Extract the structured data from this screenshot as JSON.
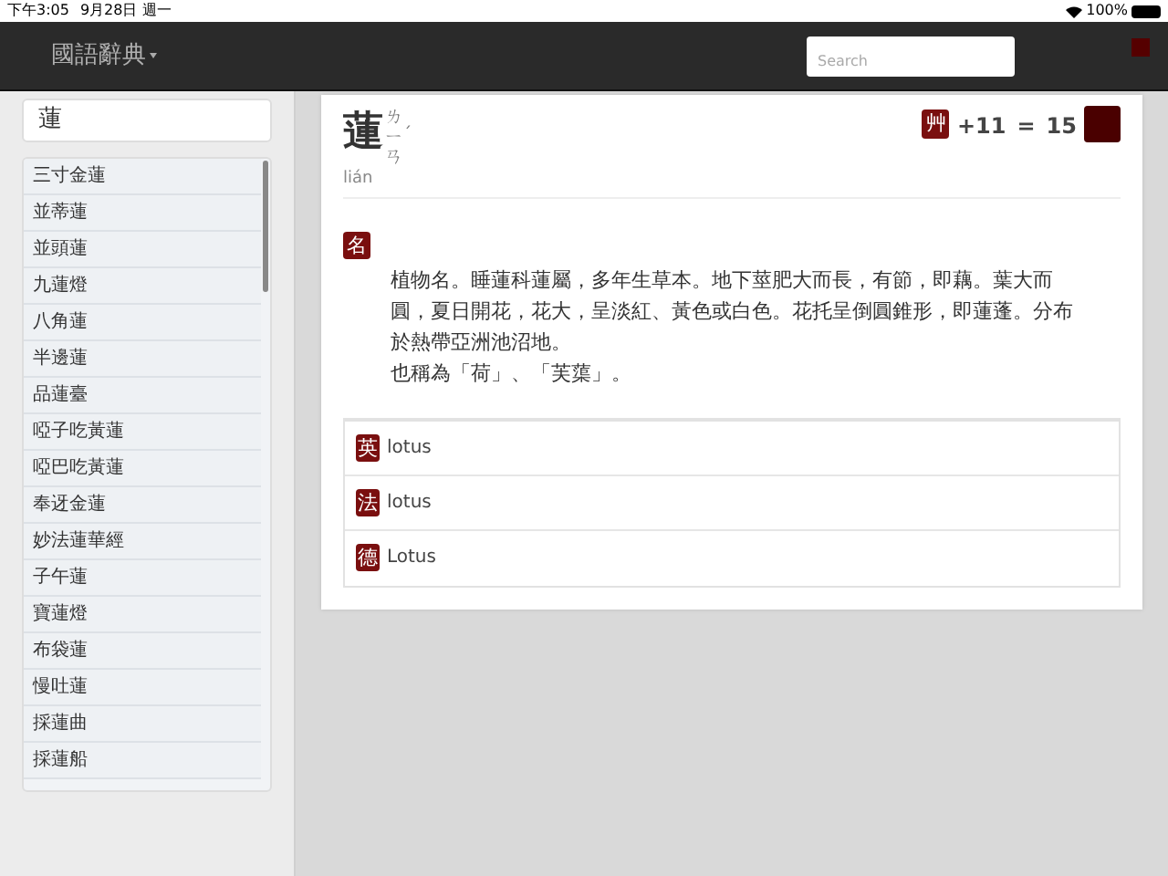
{
  "status_bar": {
    "time": "下午3:05",
    "date": "9月28日 週一",
    "battery": "100%"
  },
  "header": {
    "title": "國語辭典",
    "search": {
      "placeholder": "Search"
    }
  },
  "sidebar": {
    "search_value": "蓮",
    "items": [
      "三寸金蓮",
      "並蒂蓮",
      "並頭蓮",
      "九蓮燈",
      "八角蓮",
      "半邊蓮",
      "品蓮臺",
      "啞子吃黃蓮",
      "啞巴吃黃蓮",
      "奉迓金蓮",
      "妙法蓮華經",
      "子午蓮",
      "寶蓮燈",
      "布袋蓮",
      "慢吐蓮",
      "採蓮曲",
      "採蓮船"
    ]
  },
  "entry": {
    "character": "蓮",
    "bopomofo": "ㄌㄧㄢ",
    "tone": "ˊ",
    "pinyin": "lián",
    "radical": "艸",
    "strokes": "+11",
    "equals": "=",
    "total": "15",
    "definitions": [
      {
        "part_of_speech": "名",
        "lines": [
          "植物名。睡蓮科蓮屬，多年生草本。地下莖肥大而長，有節，即藕。葉大而圓，夏日開花，花大，呈淡紅、黃色或白色。花托呈倒圓錐形，即蓮蓬。分布於熱帶亞洲池沼地。",
          "也稱為「荷」、「芙蕖」。"
        ]
      }
    ],
    "translations": [
      {
        "language": "英",
        "text": "lotus"
      },
      {
        "language": "法",
        "text": "lotus"
      },
      {
        "language": "德",
        "text": "Lotus"
      }
    ]
  }
}
